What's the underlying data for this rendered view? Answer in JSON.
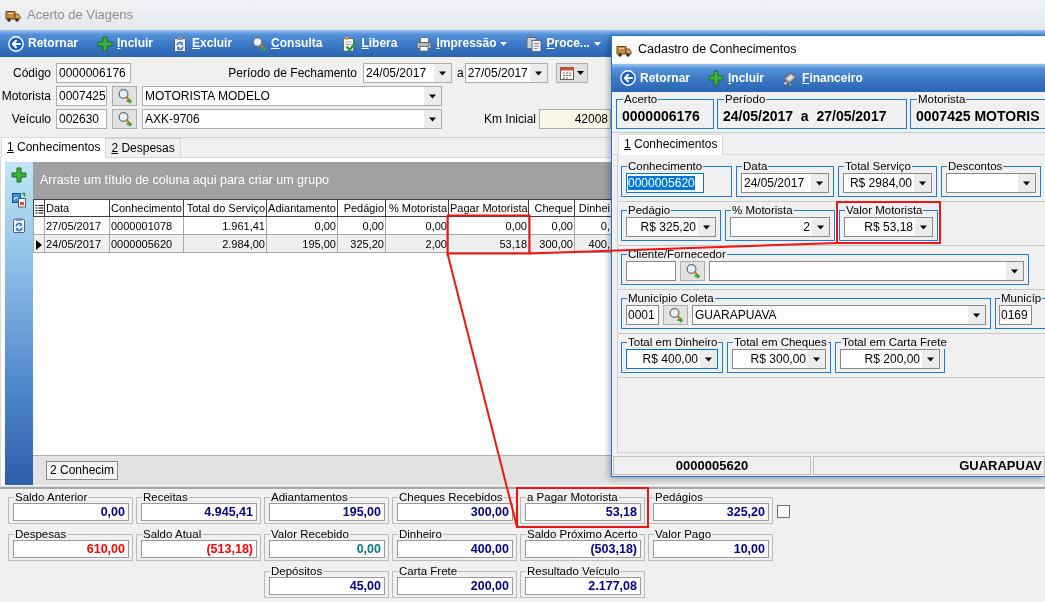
{
  "main_window": {
    "title": "Acerto de Viagens",
    "active": false
  },
  "toolbar": [
    {
      "label": "Retornar",
      "kind": "back",
      "accelerator": false,
      "dropdown": false
    },
    {
      "label": "Incluir",
      "kind": "add",
      "accelerator": true,
      "dropdown": false
    },
    {
      "label": "Excluir",
      "kind": "delete",
      "accelerator": true,
      "dropdown": false
    },
    {
      "label": "Consulta",
      "kind": "search",
      "accelerator": true,
      "dropdown": false
    },
    {
      "label": "Libera",
      "kind": "approve",
      "accelerator": true,
      "dropdown": false
    },
    {
      "label": "Impressão",
      "kind": "print",
      "accelerator": true,
      "dropdown": true
    },
    {
      "label": "Proce...",
      "kind": "process",
      "accelerator": true,
      "dropdown": true
    }
  ],
  "form": {
    "code": {
      "label": "Código",
      "value": "0000006176"
    },
    "period": {
      "label": "Período de Fechamento",
      "from": "24/05/2017",
      "separator": "a",
      "to": "27/05/2017"
    },
    "driver": {
      "label": "Motorista",
      "code": "0007425",
      "name": "MOTORISTA MODELO"
    },
    "vehicle": {
      "label": "Veículo",
      "code": "002630",
      "plate": "AXK-9706"
    },
    "km_start": {
      "label": "Km Inicial",
      "value": "42008",
      "readonly": true
    }
  },
  "tabs": [
    {
      "label": "1 Conhecimentos",
      "selected": true,
      "accelerator": true
    },
    {
      "label": "2 Despesas",
      "selected": false,
      "accelerator": true
    }
  ],
  "grid": {
    "group_hint": "Arraste um título de coluna aqui para criar um grupo",
    "columns": [
      {
        "label": "Data",
        "kind": "text"
      },
      {
        "label": "Conhecimento",
        "kind": "text"
      },
      {
        "label": "Total do Serviço",
        "kind": "number"
      },
      {
        "label": "Adiantamento",
        "kind": "number"
      },
      {
        "label": "Pedágio",
        "kind": "number"
      },
      {
        "label": "% Motorista",
        "kind": "number"
      },
      {
        "label": "Pagar Motorista",
        "kind": "number",
        "highlighted": true
      },
      {
        "label": "Cheque",
        "kind": "number"
      },
      {
        "label": "Dinhei",
        "kind": "number"
      }
    ],
    "rows": [
      {
        "selected": false,
        "cells": [
          "27/05/2017",
          "0000001078",
          "1.961,41",
          "0,00",
          "0,00",
          "0,00",
          "0,00",
          "0,00",
          "0,"
        ]
      },
      {
        "selected": true,
        "cells": [
          "24/05/2017",
          "0000005620",
          "2.984,00",
          "195,00",
          "325,20",
          "2,00",
          "53,18",
          "300,00",
          "400,"
        ]
      }
    ],
    "footer": "2 Conhecim"
  },
  "summary": [
    [
      {
        "title": "Saldo Anterior",
        "value": "0,00",
        "color": "#000080"
      },
      {
        "title": "Despesas",
        "value": "610,00",
        "color": "#ff0000"
      }
    ],
    [
      {
        "title": "Receitas",
        "value": "4.945,41",
        "color": "#000080"
      },
      {
        "title": "Saldo Atual",
        "value": "(513,18)",
        "color": "#ff0000"
      }
    ],
    [
      {
        "title": "Adiantamentos",
        "value": "195,00",
        "color": "#000080"
      },
      {
        "title": "Valor Recebido",
        "value": "0,00",
        "color": "#008080"
      },
      {
        "title": "Depósitos",
        "value": "45,00",
        "color": "#000080"
      }
    ],
    [
      {
        "title": "Cheques Recebidos",
        "value": "300,00",
        "color": "#000080"
      },
      {
        "title": "Dinheiro",
        "value": "400,00",
        "color": "#000080"
      },
      {
        "title": "Carta Frete",
        "value": "200,00",
        "color": "#000080"
      }
    ],
    [
      {
        "title": "a Pagar Motorista",
        "value": "53,18",
        "color": "#000080",
        "highlighted": true
      },
      {
        "title": "Saldo Próximo Acerto",
        "value": "(503,18)",
        "color": "#000080"
      },
      {
        "title": "Resultado Veículo",
        "value": "2.177,08",
        "color": "#000080"
      }
    ],
    [
      {
        "title": "Pedágios",
        "value": "325,20",
        "color": "#000080",
        "checked": false
      },
      {
        "title": "Valor Pago",
        "value": "10,00",
        "color": "#000080"
      }
    ]
  ],
  "dialog": {
    "title": "Cadastro de Conhecimentos",
    "active": true,
    "toolbar": [
      {
        "label": "Retornar",
        "kind": "back",
        "accelerator": false
      },
      {
        "label": "Incluir",
        "kind": "add",
        "accelerator": true
      },
      {
        "label": "Financeiro",
        "kind": "finance",
        "accelerator": true
      }
    ],
    "header": [
      {
        "label": "Acerto",
        "value": "0000006176"
      },
      {
        "label": "Período",
        "value": "24/05/2017  a  27/05/2017"
      },
      {
        "label": "Motorista",
        "value": "0007425 MOTORIS",
        "clipped": true
      }
    ],
    "tabs": [
      {
        "label": "1 Conhecimentos",
        "selected": true,
        "accelerator": true
      }
    ],
    "rows": [
      [
        {
          "label": "Conhecimento",
          "kind": "text",
          "value": "0000005620",
          "focused": true
        },
        {
          "label": "Data",
          "kind": "date",
          "value": "24/05/2017"
        },
        {
          "label": "Total Serviço",
          "kind": "amount",
          "value": "R$ 2984,00"
        },
        {
          "label": "Descontos",
          "kind": "amount"
        }
      ],
      [
        {
          "label": "Pedágio",
          "kind": "amount",
          "value": "R$ 325,20"
        },
        {
          "label": "% Motorista",
          "kind": "amount",
          "value": "2"
        },
        {
          "label": "Valor Motorista",
          "kind": "amount",
          "value": "R$ 53,18",
          "highlighted": true
        }
      ],
      [
        {
          "label": "Cliente/Fornecedor",
          "kind": "lookup"
        }
      ],
      [
        {
          "label": "Município Coleta",
          "kind": "lookup",
          "code": "0001",
          "name": "GUARAPUAVA"
        },
        {
          "label": "Municíp",
          "kind": "lookup",
          "code": "0169",
          "clipped": true
        }
      ],
      [
        {
          "label": "Total em Dinheiro",
          "kind": "amount",
          "value": "R$ 400,00",
          "focused": true
        },
        {
          "label": "Total em Cheques",
          "kind": "amount",
          "value": "R$ 300,00"
        },
        {
          "label": "Total em Carta Frete",
          "kind": "amount",
          "value": "R$ 200,00"
        }
      ]
    ],
    "status_bar": [
      "0000005620",
      "GUARAPUAV"
    ]
  }
}
